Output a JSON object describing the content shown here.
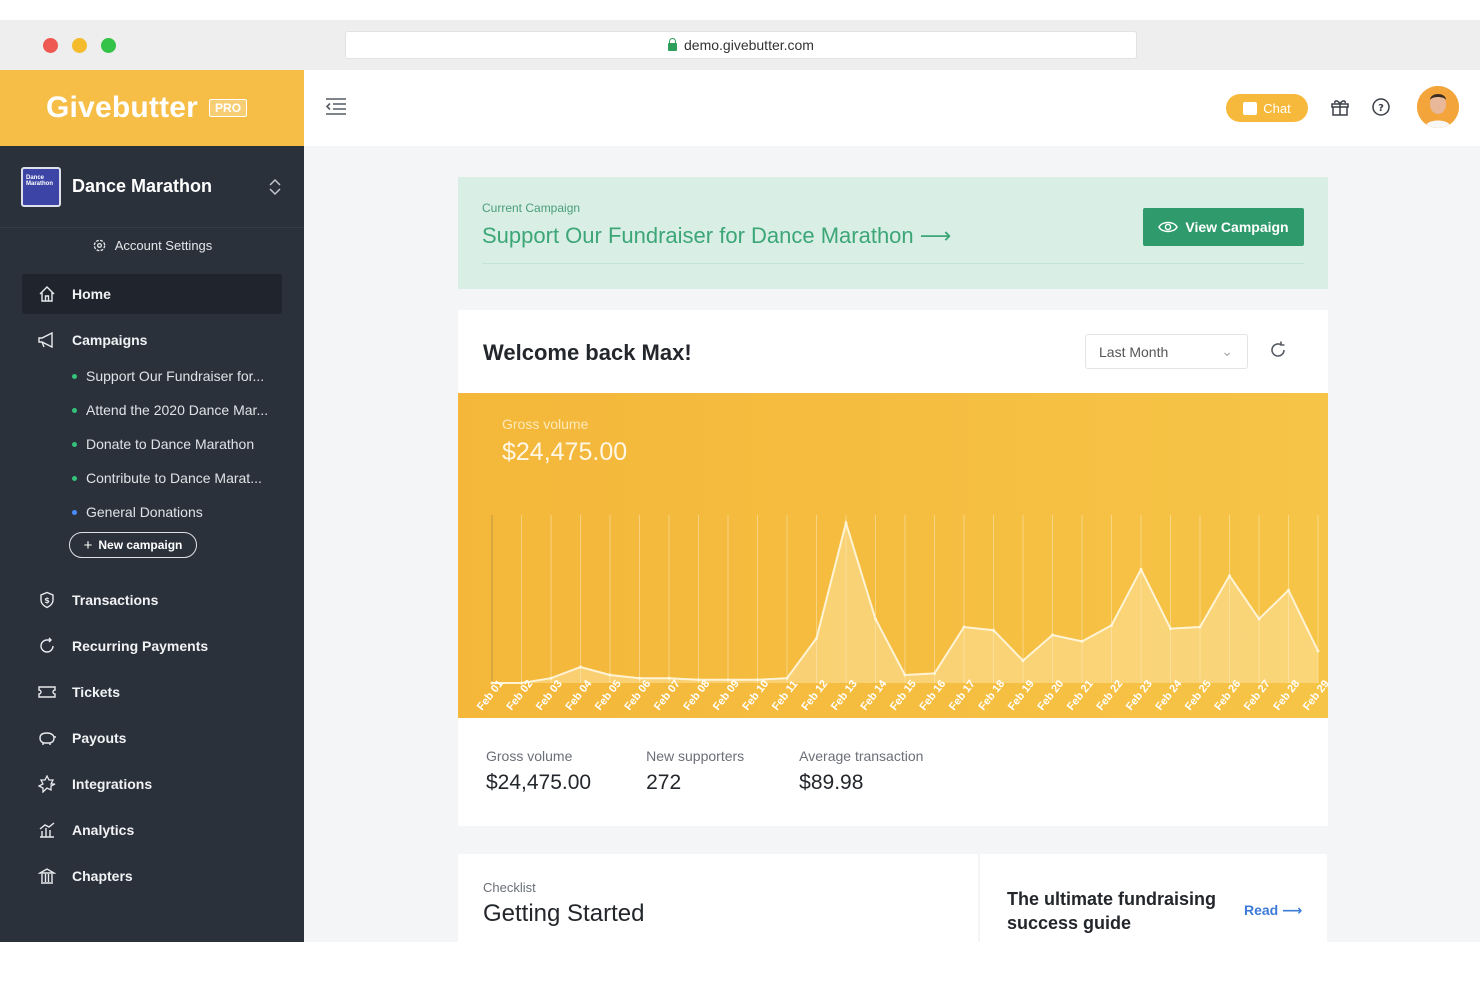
{
  "browser": {
    "url": "demo.givebutter.com"
  },
  "brand": {
    "name": "Givebutter",
    "badge": "PRO"
  },
  "org": {
    "name": "Dance Marathon",
    "logo_text": "Dance Marathon"
  },
  "account_settings_label": "Account Settings",
  "nav": {
    "home": "Home",
    "campaigns": "Campaigns",
    "campaign_items": [
      {
        "label": "Support Our Fundraiser for..."
      },
      {
        "label": "Attend the 2020 Dance Mar..."
      },
      {
        "label": "Donate to Dance Marathon"
      },
      {
        "label": "Contribute to Dance Marat..."
      },
      {
        "label": "General Donations"
      }
    ],
    "new_campaign": "New campaign",
    "transactions": "Transactions",
    "recurring": "Recurring Payments",
    "tickets": "Tickets",
    "payouts": "Payouts",
    "integrations": "Integrations",
    "analytics": "Analytics",
    "chapters": "Chapters"
  },
  "topbar": {
    "chat": "Chat"
  },
  "banner": {
    "label": "Current Campaign",
    "title": "Support Our Fundraiser for Dance Marathon ⟶",
    "button": "View Campaign"
  },
  "dashboard": {
    "welcome": "Welcome back Max!",
    "period": "Last Month",
    "gross_label": "Gross volume",
    "gross_value": "$24,475.00"
  },
  "chart_data": {
    "type": "area",
    "title": "Gross volume",
    "x": [
      "Feb 01",
      "Feb 02",
      "Feb 03",
      "Feb 04",
      "Feb 05",
      "Feb 06",
      "Feb 07",
      "Feb 08",
      "Feb 09",
      "Feb 10",
      "Feb 11",
      "Feb 12",
      "Feb 13",
      "Feb 14",
      "Feb 15",
      "Feb 16",
      "Feb 17",
      "Feb 18",
      "Feb 19",
      "Feb 20",
      "Feb 21",
      "Feb 22",
      "Feb 23",
      "Feb 24",
      "Feb 25",
      "Feb 26",
      "Feb 27",
      "Feb 28",
      "Feb 29"
    ],
    "values": [
      0,
      0,
      3,
      10,
      5,
      3,
      3,
      2,
      2,
      2,
      3,
      28,
      100,
      40,
      5,
      6,
      35,
      33,
      14,
      30,
      26,
      36,
      71,
      34,
      35,
      67,
      40,
      58,
      20
    ],
    "ylim": [
      0,
      100
    ]
  },
  "stats": [
    {
      "label": "Gross volume",
      "value": "$24,475.00"
    },
    {
      "label": "New supporters",
      "value": "272"
    },
    {
      "label": "Average transaction",
      "value": "$89.98"
    }
  ],
  "checklist": {
    "label": "Checklist",
    "title": "Getting Started"
  },
  "guide": {
    "title": "The ultimate fundraising success guide",
    "read": "Read ⟶"
  }
}
